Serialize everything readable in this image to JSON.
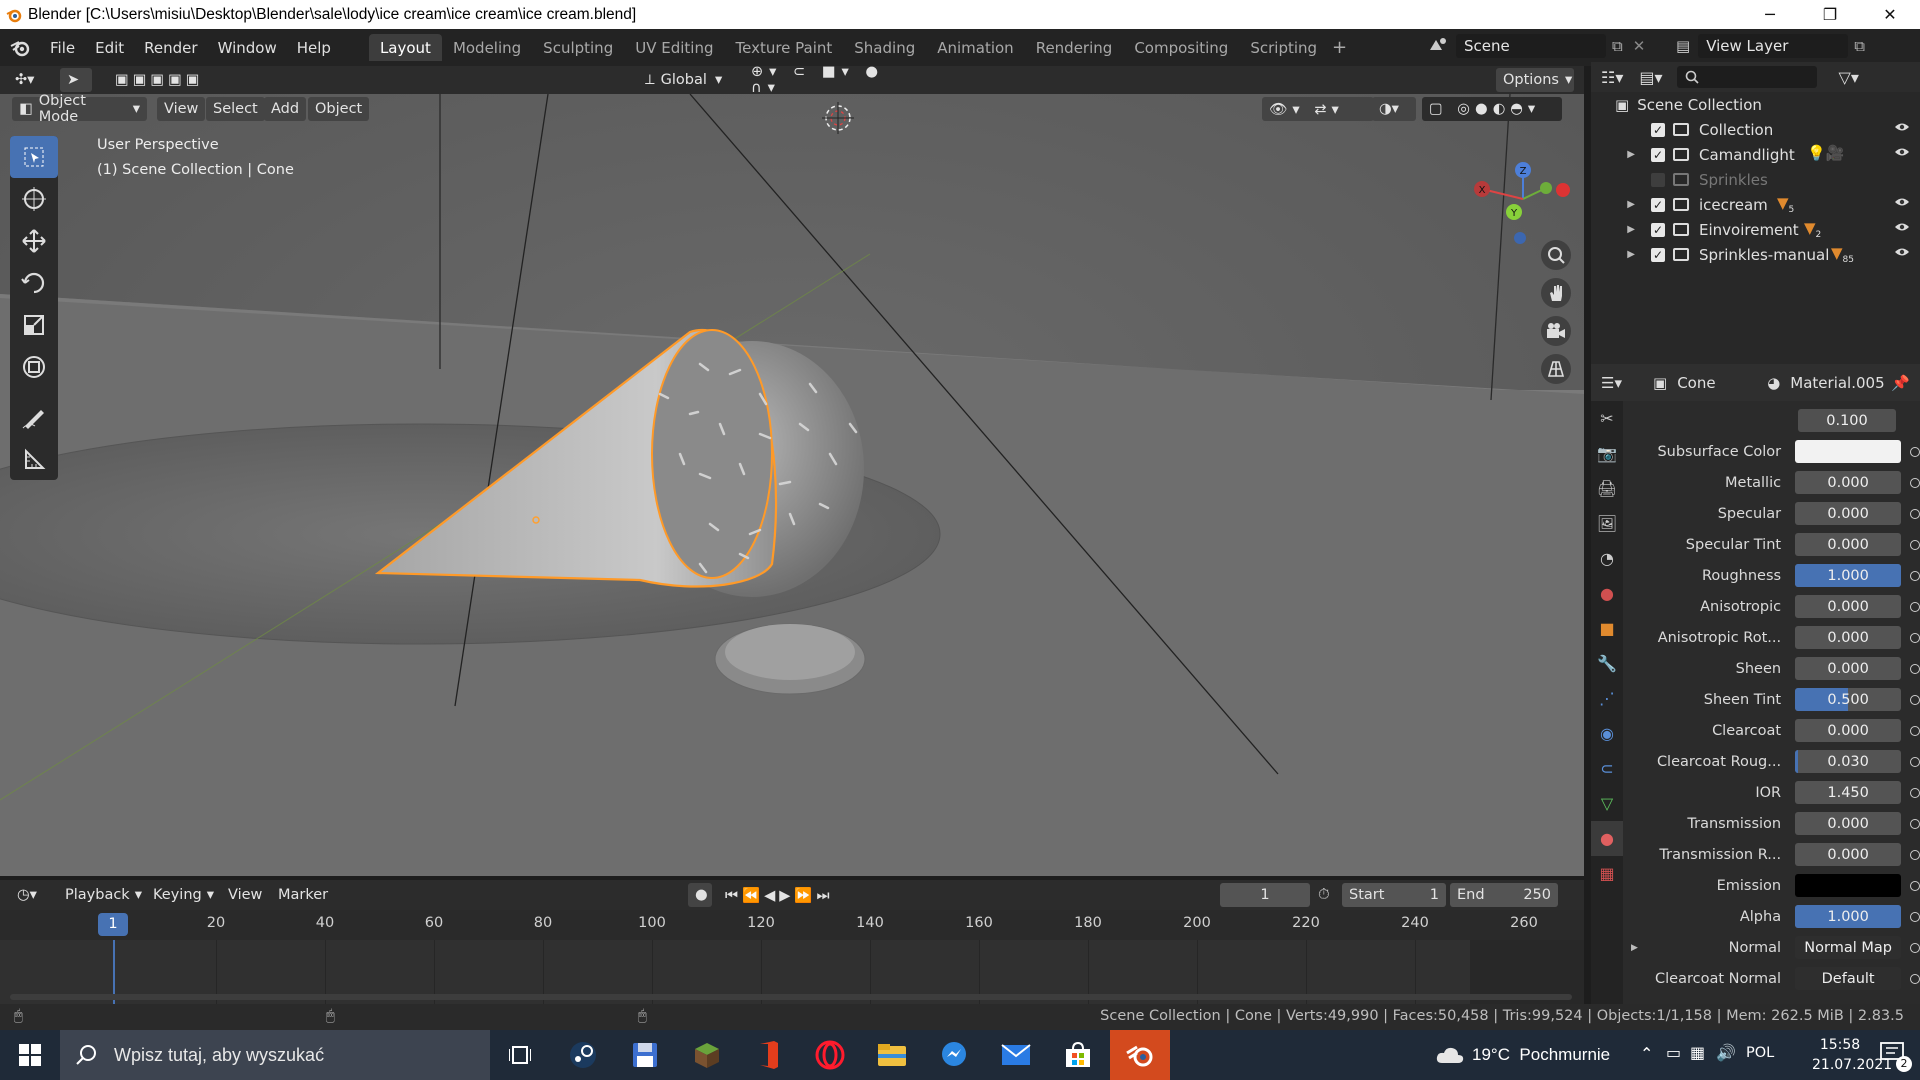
{
  "window": {
    "title": "Blender [C:\\Users\\misiu\\Desktop\\Blender\\sale\\lody\\ice cream\\ice cream\\ice cream.blend]",
    "minimize": "─",
    "maximize": "❐",
    "close": "✕"
  },
  "menu": [
    "File",
    "Edit",
    "Render",
    "Window",
    "Help"
  ],
  "workspaces": [
    "Layout",
    "Modeling",
    "Sculpting",
    "UV Editing",
    "Texture Paint",
    "Shading",
    "Animation",
    "Rendering",
    "Compositing",
    "Scripting"
  ],
  "active_workspace": "Layout",
  "scene": {
    "name": "Scene",
    "view_layer": "View Layer"
  },
  "viewport_header": {
    "transform_orientation": "Global",
    "options": "Options",
    "mode": "Object Mode",
    "menus": [
      "View",
      "Select",
      "Add",
      "Object"
    ]
  },
  "viewport": {
    "perspective_label": "User Perspective",
    "context_label": "(1) Scene Collection | Cone",
    "gizmo_axes": [
      "X",
      "Y",
      "Z"
    ]
  },
  "outliner": {
    "root": "Scene Collection",
    "items": [
      {
        "label": "Collection",
        "checked": true,
        "expandable": false,
        "visible": true,
        "badge": ""
      },
      {
        "label": "Camandlight",
        "checked": true,
        "expandable": true,
        "visible": true,
        "badge": ""
      },
      {
        "label": "Sprinkles",
        "checked": false,
        "expandable": false,
        "visible": false,
        "badge": ""
      },
      {
        "label": "icecream",
        "checked": true,
        "expandable": true,
        "visible": true,
        "badge": "5"
      },
      {
        "label": "Einvoirement",
        "checked": true,
        "expandable": true,
        "visible": true,
        "badge": "2"
      },
      {
        "label": "Sprinkles-manual",
        "checked": true,
        "expandable": true,
        "visible": true,
        "badge": "85"
      }
    ]
  },
  "properties": {
    "object": "Cone",
    "material": "Material.005",
    "top_value": "0.100",
    "rows": [
      {
        "label": "Subsurface Color",
        "value": "",
        "kind": "color",
        "color": "#f2f2f2"
      },
      {
        "label": "Metallic",
        "value": "0.000",
        "kind": "num",
        "fill": 0
      },
      {
        "label": "Specular",
        "value": "0.000",
        "kind": "num",
        "fill": 0
      },
      {
        "label": "Specular Tint",
        "value": "0.000",
        "kind": "num",
        "fill": 0
      },
      {
        "label": "Roughness",
        "value": "1.000",
        "kind": "num",
        "fill": 1
      },
      {
        "label": "Anisotropic",
        "value": "0.000",
        "kind": "num",
        "fill": 0
      },
      {
        "label": "Anisotropic Rot...",
        "value": "0.000",
        "kind": "num",
        "fill": 0
      },
      {
        "label": "Sheen",
        "value": "0.000",
        "kind": "num",
        "fill": 0
      },
      {
        "label": "Sheen Tint",
        "value": "0.500",
        "kind": "num",
        "fill": 0.5
      },
      {
        "label": "Clearcoat",
        "value": "0.000",
        "kind": "num",
        "fill": 0
      },
      {
        "label": "Clearcoat Roug...",
        "value": "0.030",
        "kind": "num",
        "fill": 0.03
      },
      {
        "label": "IOR",
        "value": "1.450",
        "kind": "num",
        "fill": 0
      },
      {
        "label": "Transmission",
        "value": "0.000",
        "kind": "num",
        "fill": 0
      },
      {
        "label": "Transmission R...",
        "value": "0.000",
        "kind": "num",
        "fill": 0
      },
      {
        "label": "Emission",
        "value": "",
        "kind": "color",
        "color": "#000000"
      },
      {
        "label": "Alpha",
        "value": "1.000",
        "kind": "num",
        "fill": 1
      },
      {
        "label": "Normal",
        "value": "Normal Map",
        "kind": "link"
      },
      {
        "label": "Clearcoat Normal",
        "value": "Default",
        "kind": "link"
      }
    ]
  },
  "timeline": {
    "menus": [
      "Playback",
      "Keying",
      "View",
      "Marker"
    ],
    "current_frame": "1",
    "start_label": "Start",
    "start": "1",
    "end_label": "End",
    "end": "250",
    "ticks": [
      "20",
      "40",
      "60",
      "80",
      "100",
      "120",
      "140",
      "160",
      "180",
      "200",
      "220",
      "240",
      "260"
    ],
    "playhead": "1"
  },
  "statusbar": {
    "info": "Scene Collection | Cone | Verts:49,990 | Faces:50,458 | Tris:99,524 | Objects:1/1,158 | Mem: 262.5 MiB | 2.83.5"
  },
  "taskbar": {
    "search_placeholder": "Wpisz tutaj, aby wyszukać",
    "weather": "19°C  Pochmurnie",
    "language": "POL",
    "time": "15:58",
    "date": "21.07.2021",
    "notifications": "2"
  }
}
